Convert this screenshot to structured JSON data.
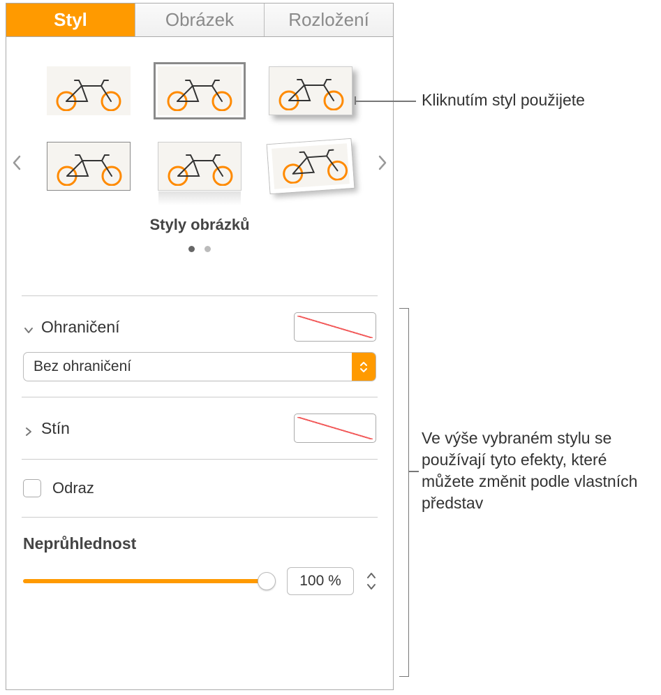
{
  "tabs": {
    "style": "Styl",
    "image": "Obrázek",
    "layout": "Rozložení"
  },
  "styles_title": "Styly obrázků",
  "border": {
    "label": "Ohraničení",
    "selected": "Bez ohraničení"
  },
  "shadow": {
    "label": "Stín"
  },
  "reflection": {
    "label": "Odraz"
  },
  "opacity": {
    "label": "Neprůhlednost",
    "value": "100 %"
  },
  "callouts": {
    "apply_style": "Kliknutím styl použijete",
    "effects": "Ve výše vybraném stylu se používají tyto efekty, které můžete změnit podle vlastních představ"
  }
}
